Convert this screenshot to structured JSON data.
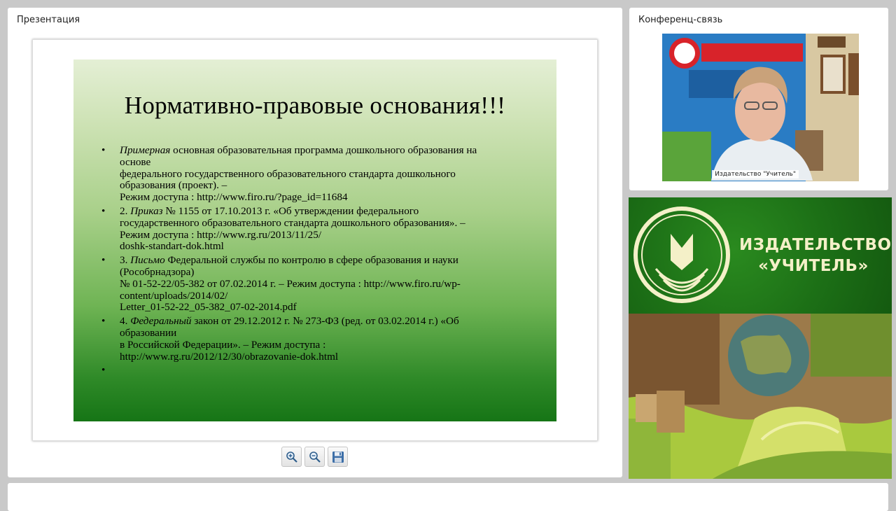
{
  "presentation": {
    "panel_title": "Презентация",
    "slide": {
      "title": "Нормативно-правовые основания!!!",
      "bullet_glyph": "•",
      "items": [
        {
          "em": "Примерная",
          "lines": [
            " основная образовательная программа дошкольного образования на",
            "основе",
            "федерального государственного образовательного стандарта дошкольного",
            "образования (проект). –",
            "Режим доступа : http://www.firo.ru/?page_id=11684"
          ]
        },
        {
          "prefix": "2. ",
          "em": "Приказ",
          "lines": [
            " № 1155 от 17.10.2013 г. «Об утверждении федерального",
            "государственного образовательного стандарта дошкольного образования». –",
            "Режим доступа : http://www.rg.ru/2013/11/25/",
            "doshk-standart-dok.html"
          ]
        },
        {
          "prefix": "3. ",
          "em": "Письмо",
          "lines": [
            " Федеральной службы по контролю в сфере образования и науки",
            "(Рособрнадзора)",
            "№ 01-52-22/05-382 от 07.02.2014 г. – Режим доступа : http://www.firo.ru/wp-",
            "content/uploads/2014/02/",
            "Letter_01-52-22_05-382_07-02-2014.pdf"
          ]
        },
        {
          "prefix": "4. ",
          "em": "Федеральный",
          "lines": [
            " закон от 29.12.2012 г. № 273-ФЗ (ред. от 03.02.2014 г.) «Об",
            "образовании",
            "в Российской Федерации». – Режим доступа :",
            "http://www.rg.ru/2012/12/30/obrazovanie-dok.html"
          ]
        },
        {
          "lines": [
            ""
          ]
        }
      ]
    },
    "tools": [
      "zoom-in-icon",
      "zoom-out-icon",
      "save-icon"
    ]
  },
  "conference": {
    "panel_title": "Конференц-связь",
    "video_label": "Издательство \"Учитель\""
  },
  "brand": {
    "name_line1": "ИЗДАТЕЛЬСТВО",
    "name_line2": "«УЧИТЕЛЬ»"
  },
  "colors": {
    "brand_green": "#1c6f16",
    "brand_text": "#f4f0c8"
  }
}
